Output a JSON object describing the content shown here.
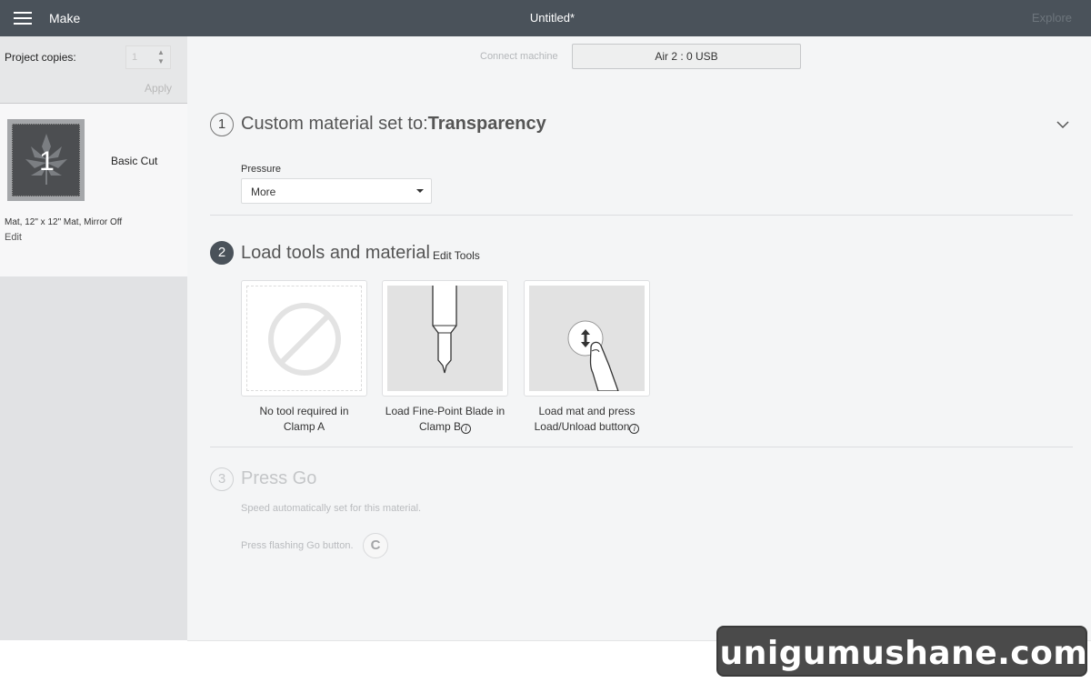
{
  "topbar": {
    "menu_label": "Make",
    "title": "Untitled*",
    "explore_label": "Explore"
  },
  "sidebar": {
    "copies_label": "Project copies:",
    "copies_value": "1",
    "apply_label": "Apply",
    "mat": {
      "number": "1",
      "name": "Basic Cut",
      "description": "Mat, 12\" x 12\" Mat, Mirror Off",
      "edit_label": "Edit"
    }
  },
  "connect": {
    "label": "Connect machine",
    "machine": "Air 2 : 0 USB"
  },
  "steps": [
    {
      "number": "1",
      "title_prefix": "Custom material set to:",
      "title_value": "Transparency",
      "pressure_label": "Pressure",
      "pressure_value": "More"
    },
    {
      "number": "2",
      "title": "Load tools and material",
      "edit_tools_label": "Edit Tools",
      "cards": [
        {
          "line1": "No tool required in",
          "line2": "Clamp A",
          "icon": "no-tool-icon"
        },
        {
          "line1": "Load Fine-Point Blade in",
          "line2": "Clamp B",
          "info": "i",
          "icon": "fine-point-blade-icon"
        },
        {
          "line1": "Load mat and press",
          "line2": "Load/Unload button",
          "info": "i",
          "icon": "load-unload-button-icon"
        }
      ]
    },
    {
      "number": "3",
      "title": "Press Go",
      "speed_note": "Speed automatically set for this material.",
      "go_note": "Press flashing Go button.",
      "go_icon_glyph": "C"
    }
  ],
  "watermark": "unigumushane.com",
  "colors": {
    "topbar": "#4a525a",
    "sidebar": "#e1e2e4",
    "main_bg": "#f4f5f6",
    "step_filled": "#4a525a"
  }
}
